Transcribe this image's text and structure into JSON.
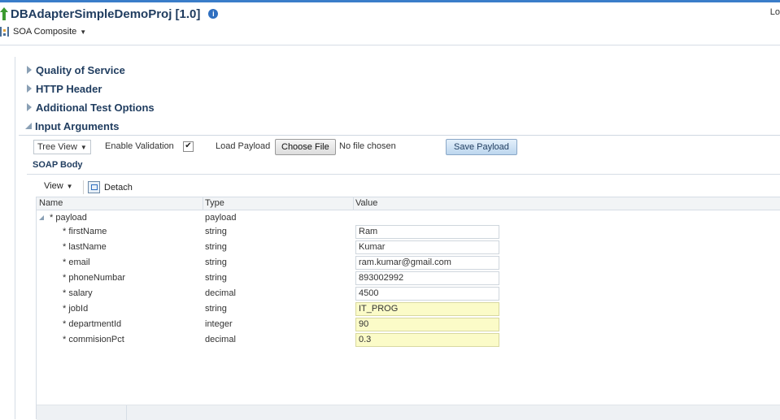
{
  "header": {
    "title": "DBAdapterSimpleDemoProj [1.0]",
    "info_glyph": "i",
    "corner_text": "Lo",
    "composite_menu_label": "SOA Composite"
  },
  "sections": [
    {
      "label": "Quality of Service",
      "expanded": false
    },
    {
      "label": "HTTP Header",
      "expanded": false
    },
    {
      "label": "Additional Test Options",
      "expanded": false
    },
    {
      "label": "Input Arguments",
      "expanded": true
    }
  ],
  "toolbar": {
    "view_select_value": "Tree View",
    "enable_validation_label": "Enable Validation",
    "enable_validation_checked": true,
    "checkmark_glyph": "✔",
    "load_payload_label": "Load Payload",
    "choose_file_label": "Choose File",
    "no_file_text": "No file chosen",
    "save_payload_label": "Save Payload"
  },
  "soap_body": {
    "title": "SOAP Body",
    "view_menu_label": "View",
    "detach_label": "Detach",
    "columns": [
      "Name",
      "Type",
      "Value"
    ],
    "root": {
      "name": "* payload",
      "type": "payload"
    },
    "rows": [
      {
        "name": "* firstName",
        "type": "string",
        "value": "Ram",
        "highlight": false
      },
      {
        "name": "* lastName",
        "type": "string",
        "value": "Kumar",
        "highlight": false
      },
      {
        "name": "* email",
        "type": "string",
        "value": "ram.kumar@gmail.com",
        "highlight": false
      },
      {
        "name": "* phoneNumbar",
        "type": "string",
        "value": "893002992",
        "highlight": false
      },
      {
        "name": "* salary",
        "type": "decimal",
        "value": "4500",
        "highlight": false
      },
      {
        "name": "* jobId",
        "type": "string",
        "value": "IT_PROG",
        "highlight": true
      },
      {
        "name": "* departmentId",
        "type": "integer",
        "value": "90",
        "highlight": true
      },
      {
        "name": "* commisionPct",
        "type": "decimal",
        "value": "0.3",
        "highlight": true
      }
    ]
  },
  "colors": {
    "accent": "#3a7dc9",
    "title_text": "#1f3c5f",
    "required_field_bg": "#fbfbc8"
  }
}
